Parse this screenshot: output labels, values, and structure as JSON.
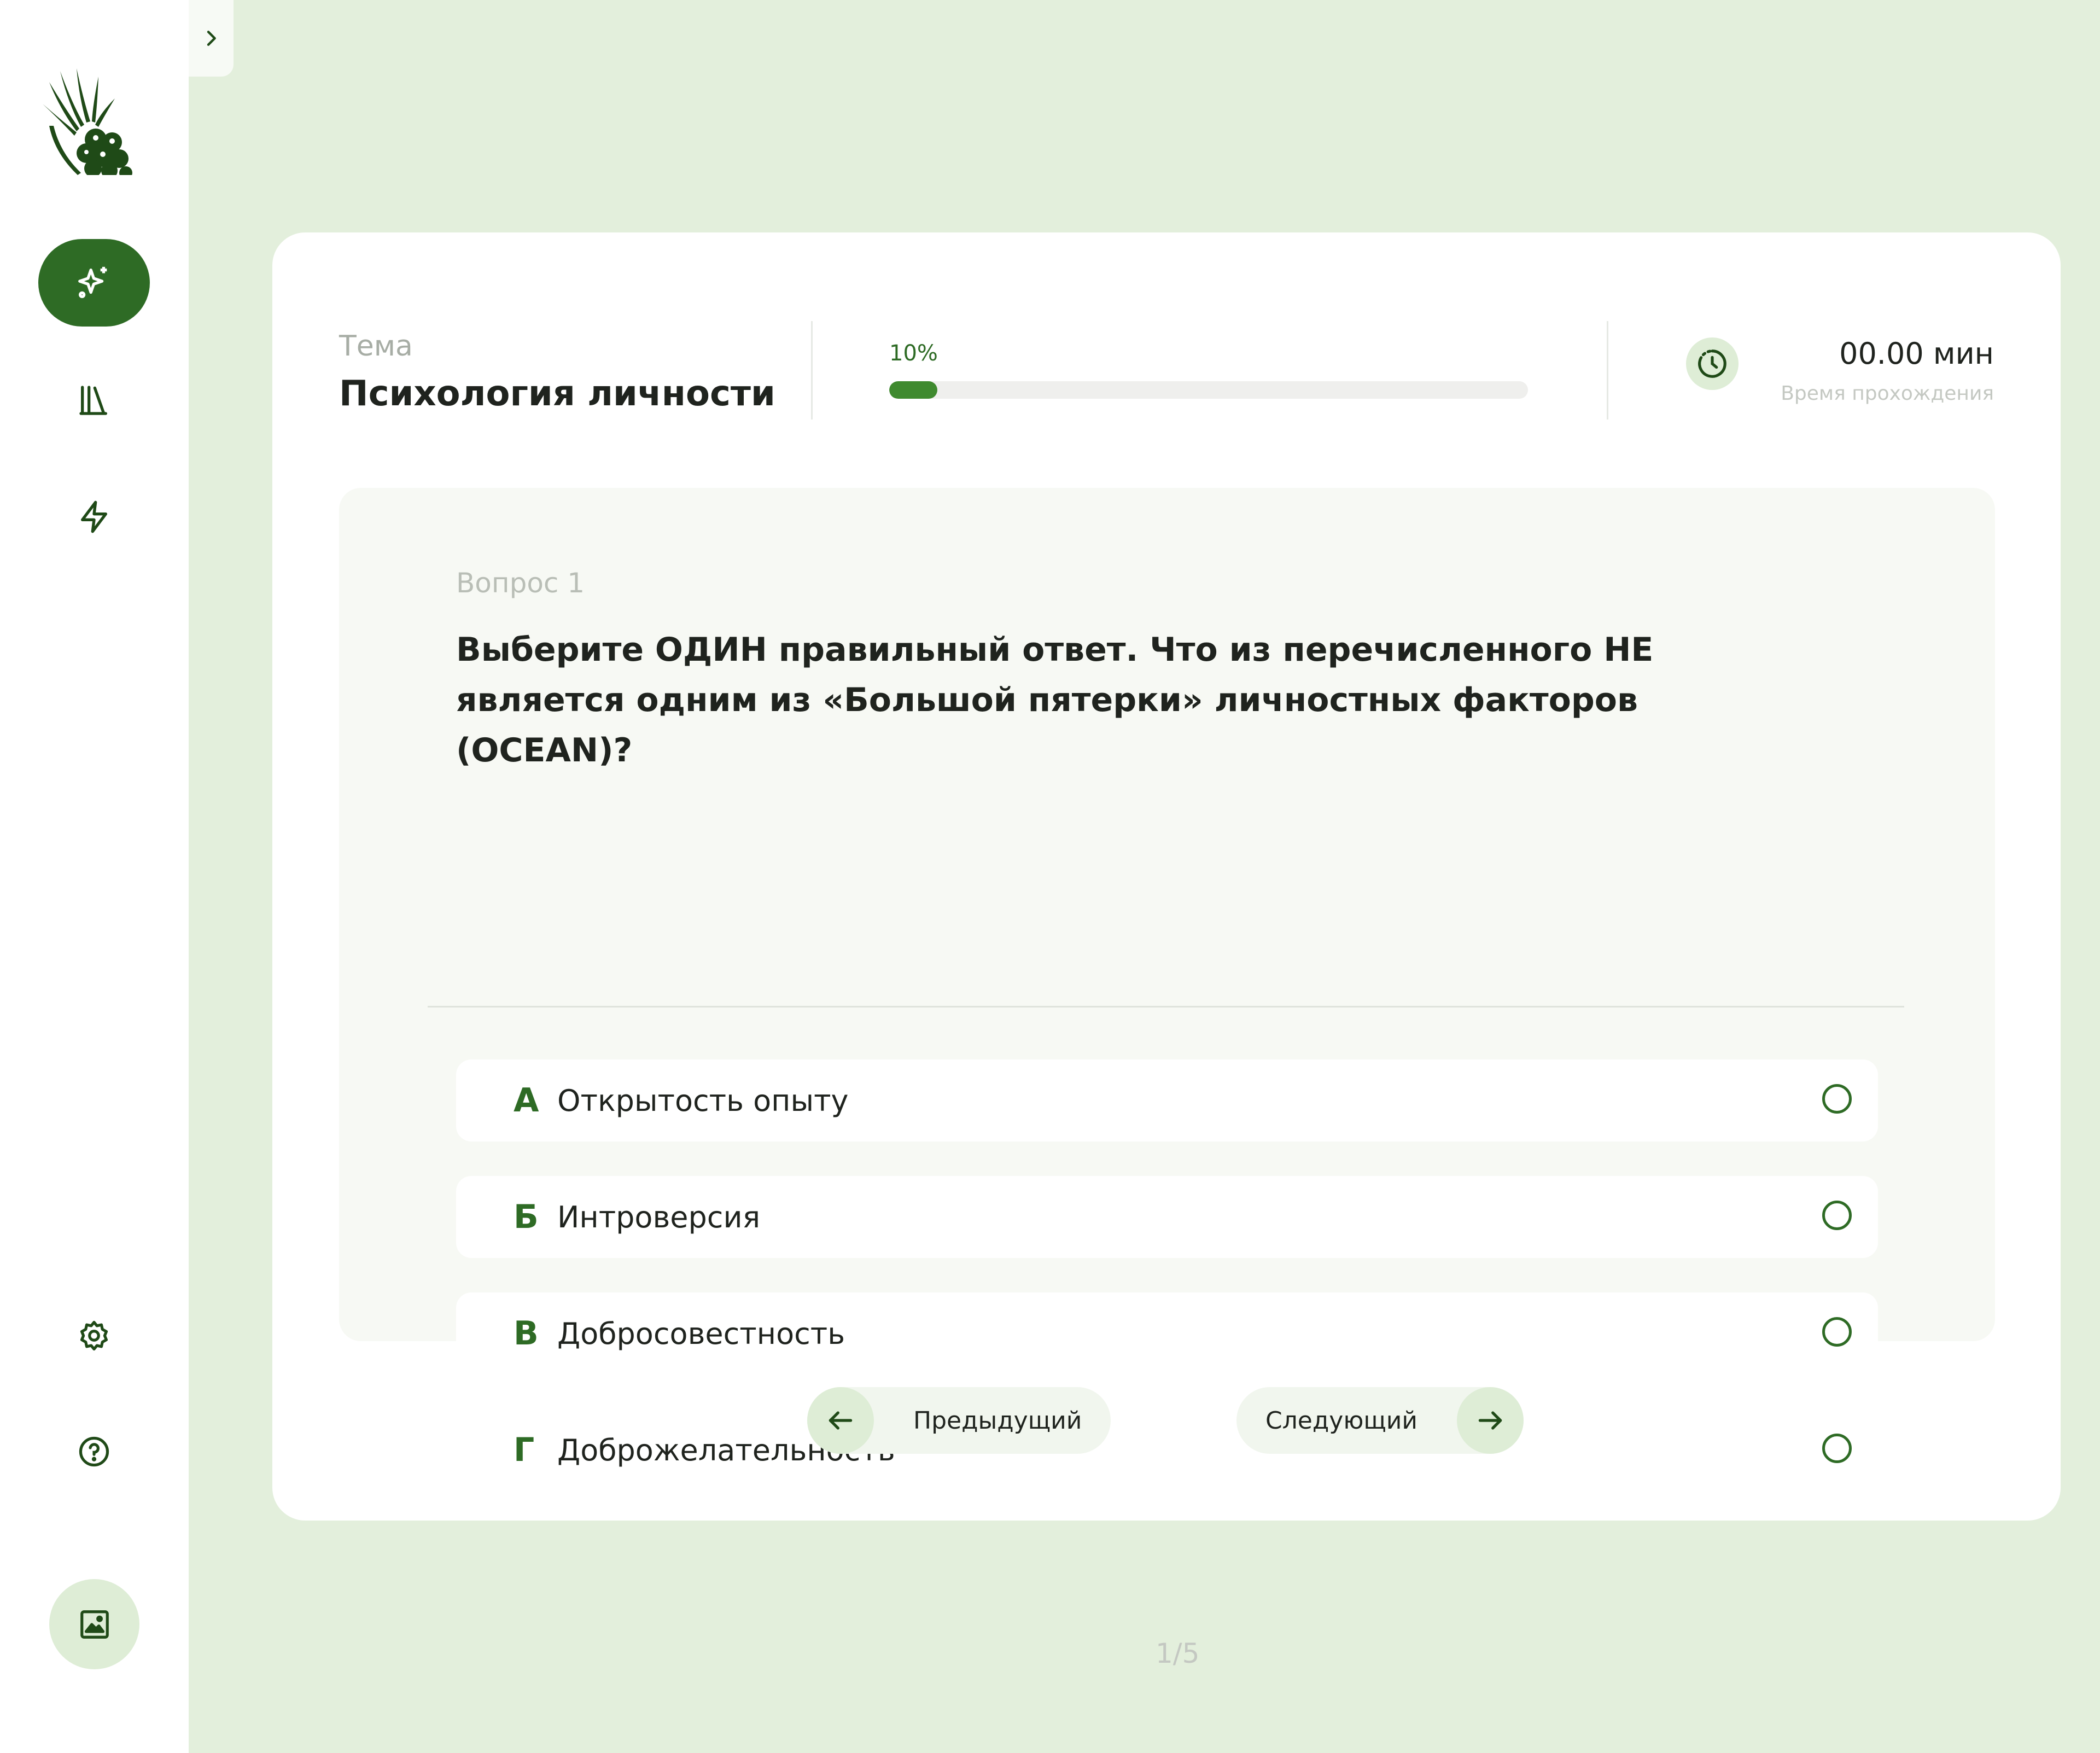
{
  "sidebar": {
    "nav": [
      {
        "icon": "sparkles-icon",
        "active": true
      },
      {
        "icon": "library-icon",
        "active": false
      },
      {
        "icon": "lightning-icon",
        "active": false
      }
    ],
    "bottom": [
      {
        "icon": "gear-icon"
      },
      {
        "icon": "help-icon"
      },
      {
        "icon": "image-icon"
      }
    ]
  },
  "quiz": {
    "topic_label": "Тема",
    "topic_name": "Психология личности",
    "progress_label": "10%",
    "progress_value": 0.075,
    "time_value": "00.00 мин",
    "time_label": "Время прохождения",
    "question_number": "Вопрос 1",
    "question_text": "Выберите ОДИН правильный ответ. Что из перечисленного НЕ является одним из «Большой пятерки» личностных факторов (OCEAN)?",
    "options": [
      {
        "letter": "А",
        "text": "Открытость опыту"
      },
      {
        "letter": "Б",
        "text": "Интроверсия"
      },
      {
        "letter": "В",
        "text": "Добросовестность"
      },
      {
        "letter": "Г",
        "text": "Доброжелательность"
      }
    ],
    "prev_label": "Предыдущий",
    "next_label": "Следующий",
    "page_indicator": "1/5"
  },
  "colors": {
    "accent": "#2e6b25",
    "background": "#e3efdc",
    "progress_fill": "#3f8a2f"
  }
}
